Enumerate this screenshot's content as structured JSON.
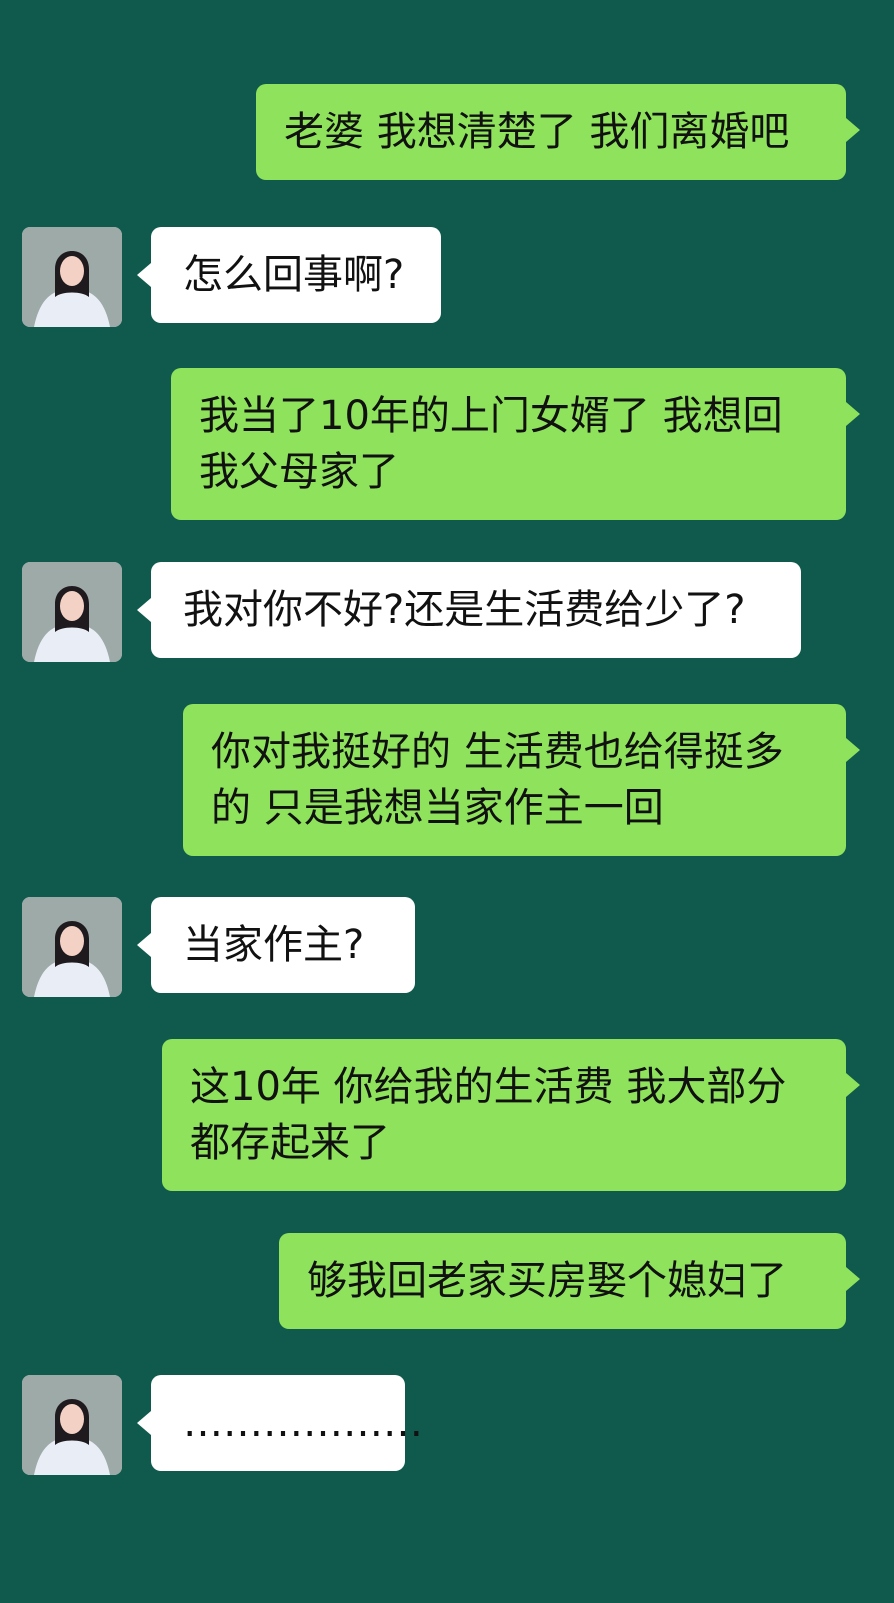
{
  "messages": [
    {
      "sender": "me",
      "text": "老婆 我想清楚了 我们离婚吧"
    },
    {
      "sender": "her",
      "text": "怎么回事啊?"
    },
    {
      "sender": "me",
      "text": "我当了10年的上门女婿了 我想回我父母家了"
    },
    {
      "sender": "her",
      "text": "我对你不好?还是生活费给少了?"
    },
    {
      "sender": "me",
      "text": "你对我挺好的 生活费也给得挺多的 只是我想当家作主一回"
    },
    {
      "sender": "her",
      "text": "当家作主?"
    },
    {
      "sender": "me",
      "text": "这10年 你给我的生活费 我大部分都存起来了"
    },
    {
      "sender": "me",
      "text": "够我回老家买房娶个媳妇了"
    },
    {
      "sender": "her",
      "text": "………………"
    }
  ],
  "colors": {
    "background": "#0f5a4c",
    "my_bubble": "#8fe35c",
    "her_bubble": "#ffffff",
    "text": "#111111"
  },
  "icons": {
    "avatar": "female-profile-photo"
  }
}
